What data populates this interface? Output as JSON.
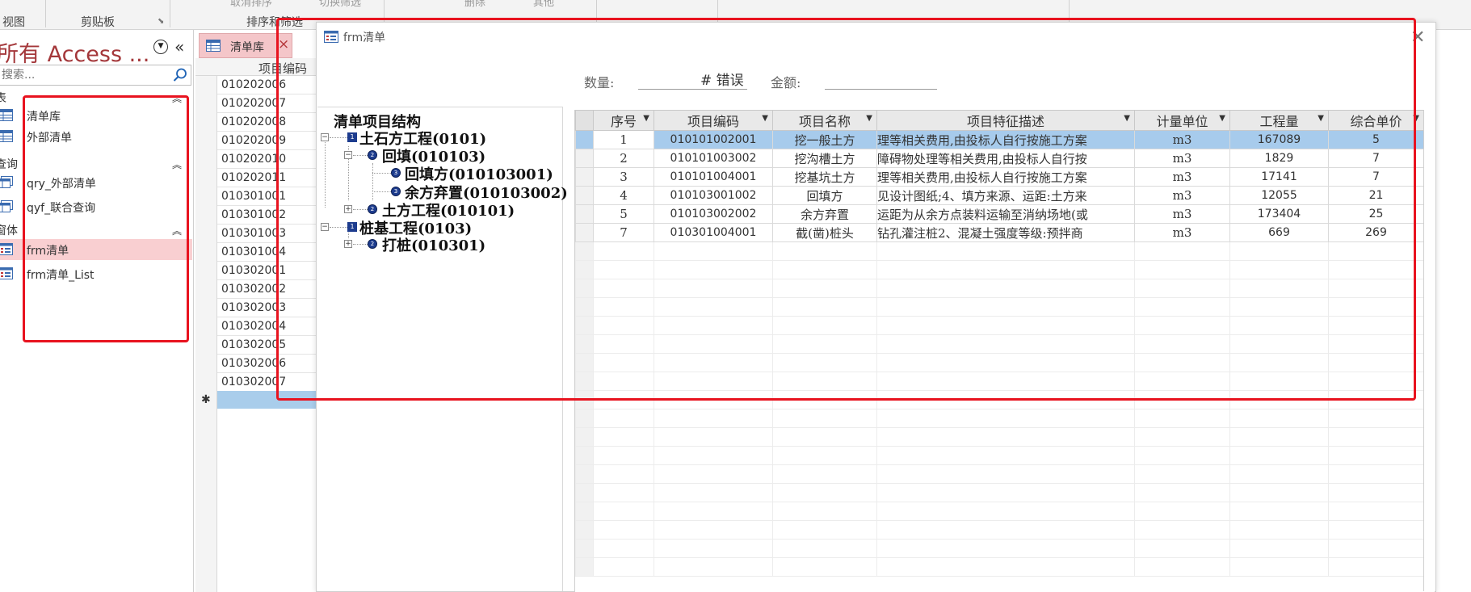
{
  "ribbon": {
    "groups": [
      {
        "label": "视图"
      },
      {
        "label": "剪贴板"
      },
      {
        "label": "排序和筛选"
      }
    ],
    "cut_texts": [
      "取消排序",
      "切换筛选",
      "删除",
      "其他"
    ]
  },
  "nav": {
    "title": "所有 Access ...",
    "search_placeholder": "搜索...",
    "sections": [
      {
        "label": "表",
        "items": [
          "清单库",
          "外部清单"
        ]
      },
      {
        "label": "查询",
        "items": [
          "qry_外部清单",
          "qyf_联合查询"
        ]
      },
      {
        "label": "窗体",
        "items": [
          "frm清单",
          "frm清单_List"
        ]
      }
    ],
    "selected_item": "frm清单"
  },
  "datasheet": {
    "tab_label": "清单库",
    "column_header": "项目编码",
    "rows": [
      "010202006",
      "010202007",
      "010202008",
      "010202009",
      "010202010",
      "010202011",
      "010301001",
      "010301002",
      "010301003",
      "010301004",
      "010302001",
      "010302002",
      "010302003",
      "010302004",
      "010302005",
      "010302006",
      "010302007"
    ],
    "new_row_marker": "✱"
  },
  "form": {
    "title": "frm清单",
    "close_glyph": "✕",
    "qty_label": "数量:",
    "qty_value": "# 错误",
    "amount_label": "金额:",
    "amount_value": "",
    "tree": {
      "root": "清单项目结构",
      "nodes": [
        {
          "text": "土石方工程(0101)",
          "level": 1,
          "toggle": "−",
          "badge": "1"
        },
        {
          "text": "回填(010103)",
          "level": 2,
          "toggle": "−",
          "badge": "2"
        },
        {
          "text": "回填方(010103001)",
          "level": 3,
          "toggle": "",
          "badge": "3"
        },
        {
          "text": "余方弃置(010103002)",
          "level": 3,
          "toggle": "",
          "badge": "3"
        },
        {
          "text": "土方工程(010101)",
          "level": 2,
          "toggle": "+",
          "badge": "2"
        },
        {
          "text": "桩基工程(0103)",
          "level": 1,
          "toggle": "−",
          "badge": "1"
        },
        {
          "text": "打桩(010301)",
          "level": 2,
          "toggle": "+",
          "badge": "2"
        }
      ]
    },
    "grid": {
      "columns": [
        "序号",
        "项目编码",
        "项目名称",
        "项目特征描述",
        "计量单位",
        "工程量",
        "综合单价"
      ],
      "rows": [
        [
          "1",
          "010101002001",
          "挖一般土方",
          "理等相关费用,由投标人自行按施工方案",
          "m3",
          "167089",
          "5"
        ],
        [
          "2",
          "010101003002",
          "挖沟槽土方",
          "障碍物处理等相关费用,由投标人自行按",
          "m3",
          "1829",
          "7"
        ],
        [
          "3",
          "010101004001",
          "挖基坑土方",
          "理等相关费用,由投标人自行按施工方案",
          "m3",
          "17141",
          "7"
        ],
        [
          "4",
          "010103001002",
          "回填方",
          "见设计图纸;4、填方来源、运距:土方来",
          "m3",
          "12055",
          "21"
        ],
        [
          "5",
          "010103002002",
          "余方弃置",
          "运距为从余方点装料运输至消纳场地(或",
          "m3",
          "173404",
          "25"
        ],
        [
          "7",
          "010301004001",
          "截(凿)桩头",
          "钻孔灌注桩2、混凝土强度等级:预拌商",
          "m3",
          "669",
          "269"
        ]
      ],
      "selected_row": 0
    }
  }
}
